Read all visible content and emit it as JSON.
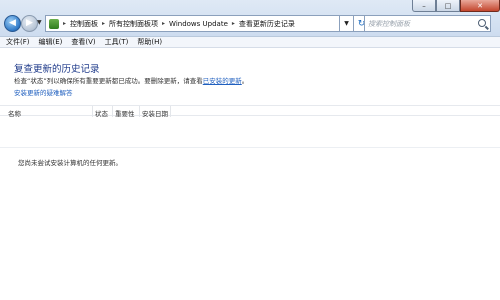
{
  "window": {
    "controls": {
      "minimize": "–",
      "maximize": "□",
      "close": "✕"
    }
  },
  "nav": {
    "back_icon": "back-arrow-icon",
    "forward_icon": "forward-arrow-icon",
    "dropdown_icon": "chevron-down-icon"
  },
  "address": {
    "breadcrumbs": [
      "控制面板",
      "所有控制面板项",
      "Windows Update",
      "查看更新历史记录"
    ],
    "refresh_icon": "refresh-icon"
  },
  "search": {
    "placeholder": "搜索控制面板"
  },
  "menu": {
    "items": [
      "文件(F)",
      "编辑(E)",
      "查看(V)",
      "工具(T)",
      "帮助(H)"
    ]
  },
  "page": {
    "title": "复查更新的历史记录",
    "description_prefix": "检查“状态”列以确保所有重要更新都已成功。要删除更新，请查看",
    "description_link": "已安装的更新",
    "description_suffix": "。",
    "troubleshoot_link": "安装更新的疑难解答"
  },
  "table": {
    "columns": [
      "名称",
      "状态",
      "重要性",
      "安装日期"
    ],
    "empty_message": "您尚未尝试安装计算机的任何更新。"
  },
  "colors": {
    "title_blue": "#1e3a8a",
    "link_blue": "#1f5fbf"
  }
}
